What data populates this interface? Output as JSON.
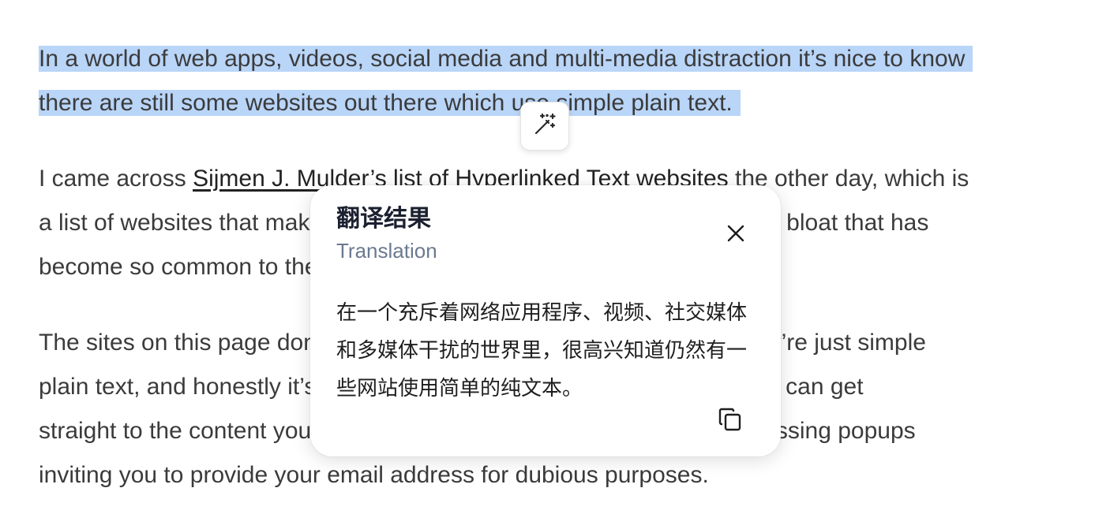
{
  "article": {
    "p1": {
      "line1": "In a world of web apps, videos, social media and multi-media distraction it’s nice to know",
      "line2": "there are still some websites out there which use simple plain text."
    },
    "p2": {
      "line1_pre": "I came across ",
      "line1_link": "Sijmen J. Mulder’s list of Hyperlinked Text websites",
      "line1_post": " the other day, which is",
      "line2": "a list of websites that make a point of avoiding the CSS and JavaScript bloat that has",
      "line3": "become so common to the modern web."
    },
    "p3": {
      "line1": "The sites on this page don’t have big banner ads or fancy images, they’re just simple",
      "line2": "plain text, and honestly it’s refreshing. They load blazingly fast and you can get",
      "line3": "straight to the content you’re after without accepting cookies and dismissing popups",
      "line4": "inviting you to provide your email address for dubious purposes."
    }
  },
  "wand": {
    "icon": "magic-wand-icon"
  },
  "popup": {
    "title": "翻译结果",
    "subtitle": "Translation",
    "text": "在一个充斥着网络应用程序、视频、社交媒体和多媒体干扰的世界里，很高兴知道仍然有一些网站使用简单的纯文本。",
    "close_icon": "close-icon",
    "copy_icon": "copy-icon"
  },
  "colors": {
    "selection": "#b9d5f8",
    "body_text": "#3b3b3b",
    "popup_title": "#1b2030",
    "popup_subtitle": "#6b7a90"
  }
}
